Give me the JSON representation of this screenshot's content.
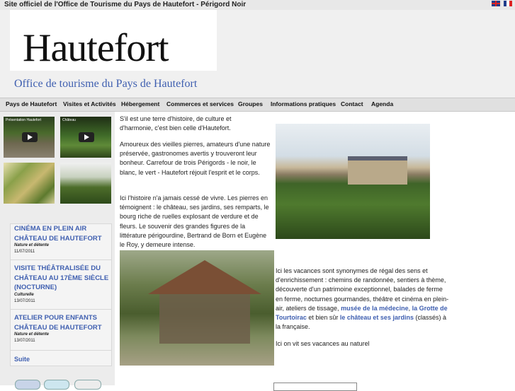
{
  "site_title": "Site officiel de l'Office de Tourisme du Pays de Hautefort - Périgord Noir",
  "header": {
    "logo": "Hautefort",
    "tagline": "Office de tourisme du Pays de Hautefort"
  },
  "nav": [
    "Pays de Hautefort",
    "Visites et Activités",
    "Hébergement",
    "Commerces et services",
    "Groupes",
    "Informations pratiques",
    "Contact",
    "Agenda"
  ],
  "videos": [
    "Présentation Hautefort",
    "Château"
  ],
  "events": [
    {
      "title": "CINÉMA EN PLEIN AIR CHÂTEAU DE HAUTEFORT",
      "category": "Nature et détente",
      "date": "11/07/2011"
    },
    {
      "title": "VISITE THÉÂTRALISÉE DU CHÂTEAU AU 17ÈME SIÈCLE (NOCTURNE)",
      "category": "Culturelle",
      "date": "13/07/2011"
    },
    {
      "title": "ATELIER POUR ENFANTS CHÂTEAU DE HAUTEFORT",
      "category": "Nature et détente",
      "date": "13/07/2011"
    }
  ],
  "events_more": "Suite",
  "content": {
    "p1": "S'il est une terre d'histoire, de culture et d'harmonie, c'est bien celle d'Hautefort.",
    "p2": "Amoureux des vieilles pierres, amateurs d'une nature préservée, gastronomes avertis y trouveront leur bonheur. Carrefour de trois Périgords - le noir, le blanc, le vert - Hautefort réjouit l'esprit et le corps.",
    "p3": "Ici l'histoire n'a jamais cessé de vivre. Les pierres en témoignent : le château, ses jardins, ses remparts, le bourg riche de ruelles explosant de verdure et de fleurs. Le souvenir des grandes figures de la littérature périgourdine, Bertrand de Born et Eugène le Roy, y demeure intense.",
    "p4_start": "Ici les vacances sont synonymes de régal des sens et d'enrichissement : chemins de randonnée, sentiers à thème, découverte d'un patrimoine exceptionnel, balades de ferme en ferme, nocturnes gourmandes, théâtre et cinéma en plein-air, ateliers de tissage,",
    "link_musee": "musée de la médecine",
    "p4_mid": ",",
    "link_grotte": "la Grotte de Tourtoirac",
    "p4_and": "et bien sûr",
    "link_chateau": "le château et ses jardins",
    "p4_end": "(classés) à la française.",
    "p5": "Ici on vit ses vacances au naturel"
  }
}
